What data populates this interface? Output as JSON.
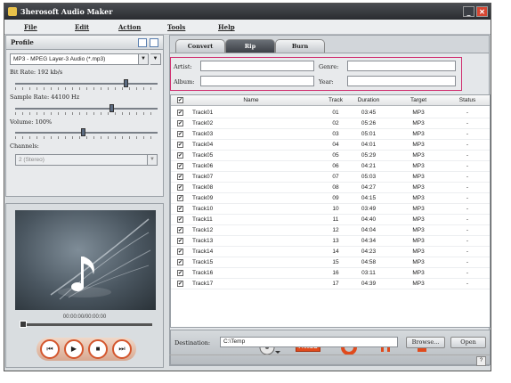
{
  "window": {
    "title": "3herosoft Audio Maker",
    "minimize": "_",
    "close": "✕",
    "accent": "#d64632"
  },
  "menu": [
    "File",
    "Edit",
    "Action",
    "Tools",
    "Help"
  ],
  "profile": {
    "header": "Profile",
    "format": "MP3 - MPEG Layer-3 Audio  (*.mp3)",
    "bitrate_label": "Bit Rate: 192 kb/s",
    "bitrate_level": 0.78,
    "samplerate_label": "Sample Rate: 44100 Hz",
    "samplerate_level": 0.68,
    "volume_label": "Volume: 100%",
    "volume_level": 0.48,
    "channels_label": "Channels:",
    "channels_value": "2 (Stereo)"
  },
  "player": {
    "time": "00:00:00/00:00:00",
    "buttons": [
      "⏮",
      "▶",
      "■",
      "⏭"
    ]
  },
  "tabs": [
    "Convert",
    "Rip",
    "Burn"
  ],
  "active_tab": "Rip",
  "tags": {
    "artist": "Artist:",
    "album": "Album:",
    "genre": "Genre:",
    "year": "Year:"
  },
  "table": {
    "headers": [
      "Name",
      "Track",
      "Duration",
      "Target",
      "Status"
    ],
    "rows": [
      {
        "name": "Track01",
        "track": "01",
        "duration": "03:45",
        "target": "MP3",
        "status": "-"
      },
      {
        "name": "Track02",
        "track": "02",
        "duration": "05:26",
        "target": "MP3",
        "status": "-"
      },
      {
        "name": "Track03",
        "track": "03",
        "duration": "05:01",
        "target": "MP3",
        "status": "-"
      },
      {
        "name": "Track04",
        "track": "04",
        "duration": "04:01",
        "target": "MP3",
        "status": "-"
      },
      {
        "name": "Track05",
        "track": "05",
        "duration": "05:29",
        "target": "MP3",
        "status": "-"
      },
      {
        "name": "Track06",
        "track": "06",
        "duration": "04:21",
        "target": "MP3",
        "status": "-"
      },
      {
        "name": "Track07",
        "track": "07",
        "duration": "05:03",
        "target": "MP3",
        "status": "-"
      },
      {
        "name": "Track08",
        "track": "08",
        "duration": "04:27",
        "target": "MP3",
        "status": "-"
      },
      {
        "name": "Track09",
        "track": "09",
        "duration": "04:15",
        "target": "MP3",
        "status": "-"
      },
      {
        "name": "Track10",
        "track": "10",
        "duration": "03:49",
        "target": "MP3",
        "status": "-"
      },
      {
        "name": "Track11",
        "track": "11",
        "duration": "04:40",
        "target": "MP3",
        "status": "-"
      },
      {
        "name": "Track12",
        "track": "12",
        "duration": "04:04",
        "target": "MP3",
        "status": "-"
      },
      {
        "name": "Track13",
        "track": "13",
        "duration": "04:34",
        "target": "MP3",
        "status": "-"
      },
      {
        "name": "Track14",
        "track": "14",
        "duration": "04:23",
        "target": "MP3",
        "status": "-"
      },
      {
        "name": "Track15",
        "track": "15",
        "duration": "04:58",
        "target": "MP3",
        "status": "-"
      },
      {
        "name": "Track16",
        "track": "16",
        "duration": "03:11",
        "target": "MP3",
        "status": "-"
      },
      {
        "name": "Track17",
        "track": "17",
        "duration": "04:39",
        "target": "MP3",
        "status": "-"
      }
    ]
  },
  "actions": {
    "freedb": "FreeDB"
  },
  "destination": {
    "label": "Destination:",
    "value": "C:\\Temp",
    "browse": "Browse...",
    "open": "Open"
  },
  "help": "?"
}
